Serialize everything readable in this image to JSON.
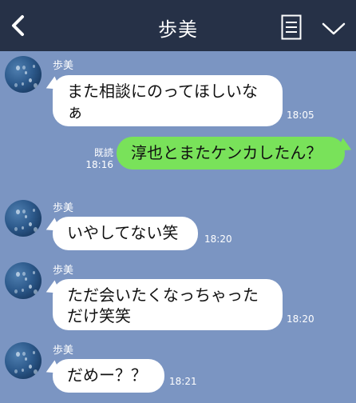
{
  "header": {
    "title": "歩美",
    "back_icon": "chevron-left-icon",
    "memo_icon": "note-icon",
    "menu_icon": "chevron-down-icon"
  },
  "messages": [
    {
      "sender": "歩美",
      "direction": "in",
      "lines": [
        "また相談にのってほしいな",
        "ぁ"
      ],
      "time": "18:05"
    },
    {
      "direction": "out",
      "read_label": "既読",
      "lines": [
        "淳也とまたケンカしたん？"
      ],
      "time": "18:16"
    },
    {
      "sender": "歩美",
      "direction": "in",
      "lines": [
        "いやしてない笑"
      ],
      "time": "18:20"
    },
    {
      "sender": "歩美",
      "direction": "in",
      "lines": [
        "ただ会いたくなっちゃった",
        "だけ笑笑"
      ],
      "time": "18:20"
    },
    {
      "sender": "歩美",
      "direction": "in",
      "lines": [
        "だめー？？"
      ],
      "time": "18:21"
    }
  ],
  "colors": {
    "header_bg": "#263147",
    "chat_bg": "#7b95c2",
    "incoming_bubble": "#ffffff",
    "outgoing_bubble": "#79e25a"
  }
}
